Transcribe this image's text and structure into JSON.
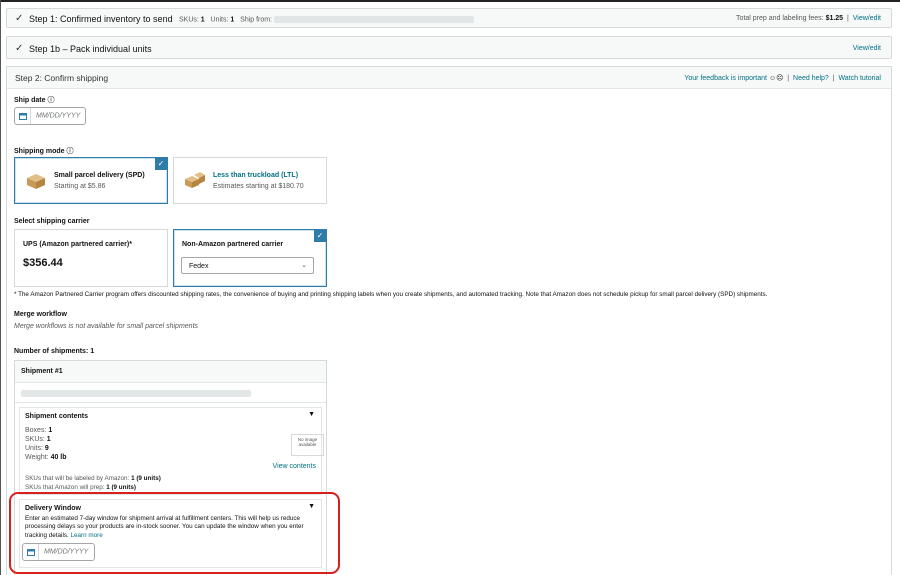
{
  "step1": {
    "title": "Step 1: Confirmed inventory to send",
    "skus_label": "SKUs:",
    "skus_value": "1",
    "units_label": "Units:",
    "units_value": "1",
    "ship_from_label": "Ship from:",
    "fees_label": "Total prep and labeling fees:",
    "fees_value": "$1.25",
    "view_edit": "View/edit"
  },
  "step1b": {
    "title": "Step 1b – Pack individual units",
    "view_edit": "View/edit"
  },
  "step2": {
    "title": "Step 2: Confirm shipping",
    "feedback": "Your feedback is important",
    "need_help": "Need help?",
    "watch_tutorial": "Watch tutorial"
  },
  "ship_date": {
    "label": "Ship date",
    "placeholder": "MM/DD/YYYY"
  },
  "shipping_mode": {
    "label": "Shipping mode",
    "options": [
      {
        "title": "Small parcel delivery (SPD)",
        "sub": "Starting at $5.86",
        "selected": true
      },
      {
        "title": "Less than truckload (LTL)",
        "sub": "Estimates starting at $180.70",
        "selected": false
      }
    ]
  },
  "carrier": {
    "label": "Select shipping carrier",
    "ups_title": "UPS (Amazon partnered carrier)*",
    "ups_price": "$356.44",
    "non_title": "Non-Amazon partnered carrier",
    "non_value": "Fedex"
  },
  "footnote": "* The Amazon Partnered Carrier program offers discounted shipping rates, the convenience of buying and printing shipping labels when you create shipments, and automated tracking. Note that Amazon does not schedule pickup for small parcel delivery (SPD) shipments.",
  "merge": {
    "label": "Merge workflow",
    "text": "Merge workflows is not available for small parcel shipments"
  },
  "num_shipments": "Number of shipments: 1",
  "shipment": {
    "title": "Shipment #1",
    "contents_title": "Shipment contents",
    "boxes_label": "Boxes:",
    "boxes": "1",
    "skus_label": "SKUs:",
    "skus": "1",
    "units_label": "Units:",
    "units": "9",
    "weight_label": "Weight:",
    "weight": "40 lb",
    "no_image": "No image available",
    "view_contents": "View contents",
    "labeled_label": "SKUs that will be labeled by Amazon:",
    "labeled": "1 (9 units)",
    "prep_label": "SKUs that Amazon will prep:",
    "prep": "1 (9 units)"
  },
  "delivery": {
    "title": "Delivery Window",
    "text": "Enter an estimated 7-day window for shipment arrival at fulfillment centers. This will help us reduce processing delays so your products are in-stock sooner. You can update the window when you enter tracking details.",
    "learn_more": "Learn more",
    "placeholder": "MM/DD/YYYY"
  },
  "colors": {
    "link": "#007185",
    "selected_border": "#2e7ca8",
    "highlight": "#d6201e"
  }
}
